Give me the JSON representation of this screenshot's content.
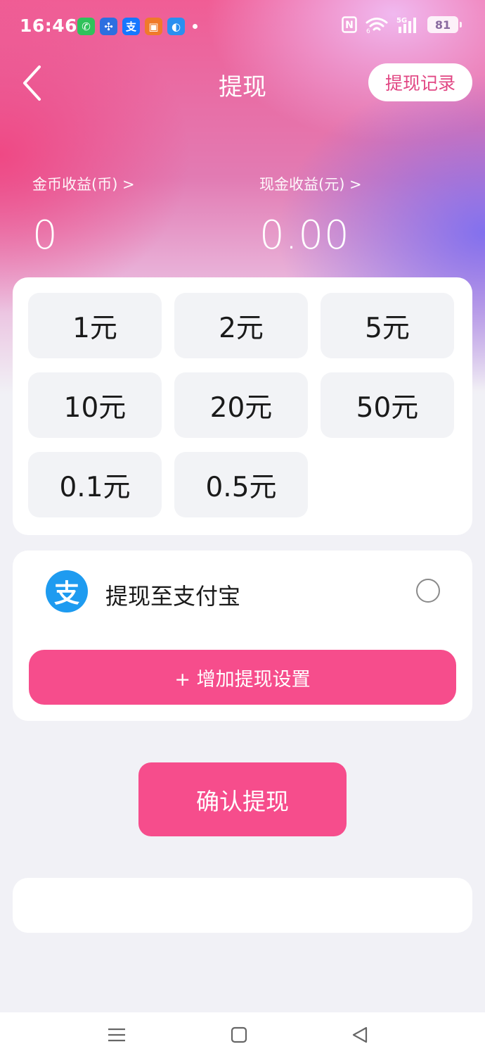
{
  "status_bar": {
    "time": "16:46",
    "app_icons": [
      {
        "icon": "wechat-icon",
        "glyph": "✆",
        "color": "#2fc25b"
      },
      {
        "icon": "pinwheel-app-icon",
        "glyph": "✣",
        "color": "#2c6fe0"
      },
      {
        "icon": "alipay-icon",
        "glyph": "支",
        "color": "#1677ff"
      },
      {
        "icon": "book-app-icon",
        "glyph": "▣",
        "color": "#f07a2a"
      },
      {
        "icon": "browser-app-icon",
        "glyph": "◐",
        "color": "#2a8ff0"
      }
    ],
    "nfc_label": "N",
    "wifi_label": "6",
    "network_label": "5G",
    "battery_level": "81"
  },
  "header": {
    "title": "提现",
    "back_icon": "chevron-left-icon",
    "record_label": "提现记录"
  },
  "earnings": {
    "coin_label": "金币收益(币) >",
    "coin_value": "0",
    "cash_label": "现金收益(元) >",
    "cash_value": "0.00"
  },
  "amounts": {
    "options": [
      "1元",
      "2元",
      "5元",
      "10元",
      "20元",
      "50元",
      "0.1元",
      "0.5元"
    ]
  },
  "payment": {
    "logo_glyph": "支",
    "method_label": "提现至支付宝",
    "selected": false,
    "add_setting_label": "+ 增加提现设置"
  },
  "confirm": {
    "label": "确认提现"
  },
  "colors": {
    "accent": "#f64d8c",
    "alipay_blue": "#1e9bf0",
    "page_bg": "#f1f1f6"
  }
}
